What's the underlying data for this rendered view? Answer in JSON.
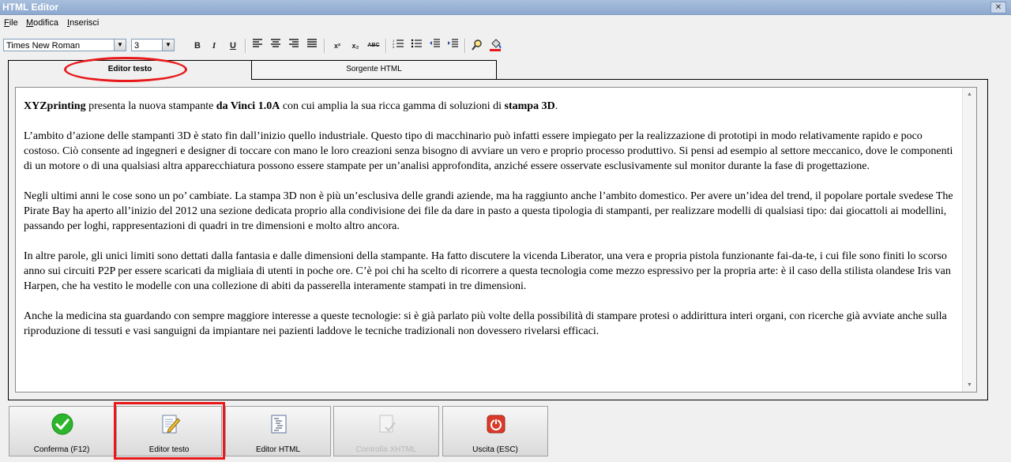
{
  "window": {
    "title": "HTML Editor",
    "close_symbol": "✕"
  },
  "menu": [
    "File",
    "Modifica",
    "Inserisci"
  ],
  "toolbar": {
    "font_name": "Times New Roman",
    "font_size": "3",
    "bold": "B",
    "italic": "I",
    "underline": "U",
    "superscript": "x²",
    "subscript": "x₂",
    "spell": "ABC"
  },
  "tabs": {
    "editor": "Editor testo",
    "source": "Sorgente HTML"
  },
  "content": {
    "p1": {
      "a": "XYZprinting",
      "b": " presenta la nuova stampante ",
      "c": "da Vinci 1.0A",
      "d": " con cui amplia la sua ricca gamma di soluzioni di ",
      "e": "stampa 3D",
      "f": "."
    },
    "p2": "L’ambito d’azione delle stampanti 3D è stato fin dall’inizio quello industriale. Questo tipo di macchinario può infatti essere impiegato per la realizzazione di prototipi in modo relativamente rapido e poco costoso. Ciò consente ad ingegneri e designer di toccare con mano le loro creazioni senza bisogno di avviare un vero e proprio processo produttivo. Si pensi ad esempio al settore meccanico, dove le componenti di un motore o di una qualsiasi altra apparecchiatura possono essere stampate per un’analisi approfondita, anziché essere osservate esclusivamente sul monitor durante la fase di progettazione.",
    "p3": "Negli ultimi anni le cose sono un po’ cambiate. La stampa 3D non è più un’esclusiva delle grandi aziende, ma ha raggiunto anche l’ambito domestico. Per avere un’idea del trend, il popolare portale svedese The Pirate Bay ha aperto all’inizio del 2012 una sezione dedicata proprio alla condivisione dei file da dare in pasto a questa tipologia di stampanti, per realizzare modelli di qualsiasi tipo: dai giocattoli ai modellini, passando per loghi, rappresentazioni di quadri in tre dimensioni e molto altro ancora.",
    "p4": "In altre parole, gli unici limiti sono dettati dalla fantasia e dalle dimensioni della stampante. Ha fatto discutere la vicenda Liberator, una vera e propria pistola funzionante fai-da-te, i cui file sono finiti lo scorso anno sui circuiti P2P per essere scaricati da migliaia di utenti in poche ore. C’è poi chi ha scelto di ricorrere a questa tecnologia come mezzo espressivo per la propria arte: è il caso della stilista olandese Iris van Harpen, che ha vestito le modelle con una collezione di abiti da passerella interamente stampati in tre dimensioni.",
    "p5": "Anche la medicina sta guardando con sempre maggiore interesse a queste tecnologie: si è già parlato più volte della possibilità di stampare protesi o addirittura interi organi, con ricerche già avviate anche sulla riproduzione di tessuti e vasi sanguigni da impiantare nei pazienti laddove le tecniche tradizionali non dovessero rivelarsi efficaci."
  },
  "buttons": {
    "confirm": "Conferma (F12)",
    "text_editor": "Editor testo",
    "html_editor": "Editor HTML",
    "check_xhtml": "Controlla XHTML",
    "exit": "Uscita (ESC)"
  },
  "colors": {
    "accent": "#e8191b",
    "confirm_green": "#2db52d",
    "exit_red": "#d93b2b"
  }
}
